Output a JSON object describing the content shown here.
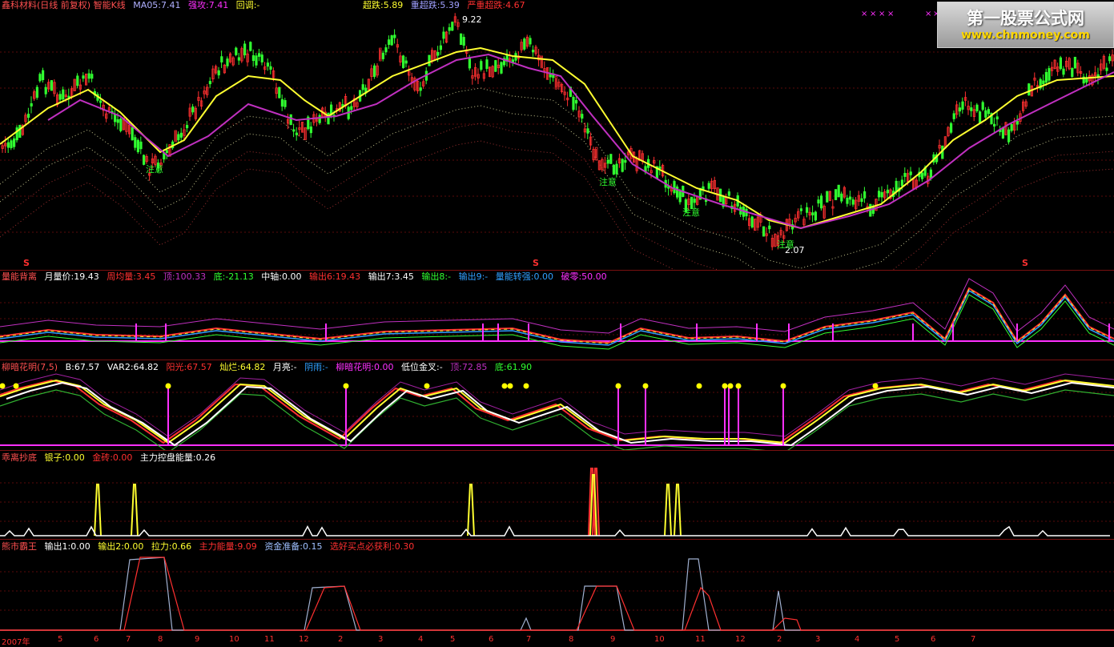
{
  "colors": {
    "up": "#ff3030",
    "down": "#30ff30",
    "ma_yellow": "#ffff30",
    "ma_purple": "#c030c0",
    "pink": "#ff30ff",
    "white": "#ffffff",
    "cyan": "#30a0ff",
    "header_red": "#ff5050",
    "dark_red": "#8b0000"
  },
  "main": {
    "title": "鑫科材料(日线 前复权) 智能K线",
    "ma5": "MA05:7.41",
    "strong": "强攻:7.41",
    "pullback": "回调:-",
    "oversold": "超跌:5.89",
    "heavy_oversold": "重超跌:5.39",
    "severe_oversold": "严重超跌:4.67",
    "high_label": "9.22",
    "low_label": "2.07",
    "notes": [
      "注意",
      "注意",
      "注意",
      "注意"
    ],
    "s_marks": [
      "S",
      "S",
      "S"
    ]
  },
  "panel2": {
    "title": "量能背离",
    "items": [
      "月量价:19.43",
      "周均量:3.45",
      "顶:100.33",
      "底:-21.13",
      "中轴:0.00",
      "输出6:19.43",
      "输出7:3.45",
      "输出8:-",
      "输出9:-",
      "量能转强:0.00",
      "破零:50.00"
    ]
  },
  "panel3": {
    "title": "柳暗花明(7,5)",
    "items": [
      "B:67.57",
      "VAR2:64.82",
      "阳光:67.57",
      "灿烂:64.82",
      "月亮:-",
      "阴雨:-",
      "柳暗花明:0.00",
      "低位金叉:-",
      "顶:72.85",
      "底:61.90"
    ]
  },
  "panel4": {
    "title": "乖离抄底",
    "items": [
      "银子:0.00",
      "金砖:0.00",
      "主力控盘能量:0.26"
    ]
  },
  "panel5": {
    "title": "熊市霸王",
    "items": [
      "输出1:0.00",
      "输出2:0.00",
      "拉力:0.66",
      "主力能量:9.09",
      "资金准备:0.15",
      "选好买点必获利:0.30"
    ]
  },
  "watermark": {
    "line1": "第一股票公式网",
    "line2": "www.chnmoney.com"
  },
  "axis_ticks": [
    "2007年",
    "5",
    "6",
    "7",
    "8",
    "9",
    "10",
    "11",
    "12",
    "2",
    "3",
    "4",
    "5",
    "6",
    "7",
    "8",
    "9",
    "10",
    "11",
    "12",
    "2",
    "3",
    "4",
    "5",
    "6",
    "7"
  ],
  "chart_data": [
    {
      "type": "line",
      "title": "鑫科材料(日线 前复权) 智能K线",
      "series": [
        {
          "name": "MA05",
          "last": 7.41
        }
      ],
      "annotations": {
        "high": 9.22,
        "low": 2.07
      }
    },
    {
      "type": "line",
      "title": "量能背离",
      "series": [
        {
          "name": "月量价",
          "last": 19.43
        },
        {
          "name": "周均量",
          "last": 3.45
        },
        {
          "name": "顶",
          "last": 100.33
        },
        {
          "name": "底",
          "last": -21.13
        },
        {
          "name": "中轴",
          "last": 0.0
        },
        {
          "name": "破零",
          "last": 50.0
        }
      ]
    },
    {
      "type": "line",
      "title": "柳暗花明(7,5)",
      "series": [
        {
          "name": "B",
          "last": 67.57
        },
        {
          "name": "VAR2",
          "last": 64.82
        },
        {
          "name": "顶",
          "last": 72.85
        },
        {
          "name": "底",
          "last": 61.9
        }
      ]
    },
    {
      "type": "line",
      "title": "乖离抄底",
      "series": [
        {
          "name": "银子",
          "last": 0.0
        },
        {
          "name": "金砖",
          "last": 0.0
        },
        {
          "name": "主力控盘能量",
          "last": 0.26
        }
      ]
    },
    {
      "type": "line",
      "title": "熊市霸王",
      "series": [
        {
          "name": "输出1",
          "last": 0.0
        },
        {
          "name": "输出2",
          "last": 0.0
        },
        {
          "name": "拉力",
          "last": 0.66
        },
        {
          "name": "主力能量",
          "last": 9.09
        },
        {
          "name": "资金准备",
          "last": 0.15
        },
        {
          "name": "选好买点必获利",
          "last": 0.3
        }
      ]
    }
  ]
}
